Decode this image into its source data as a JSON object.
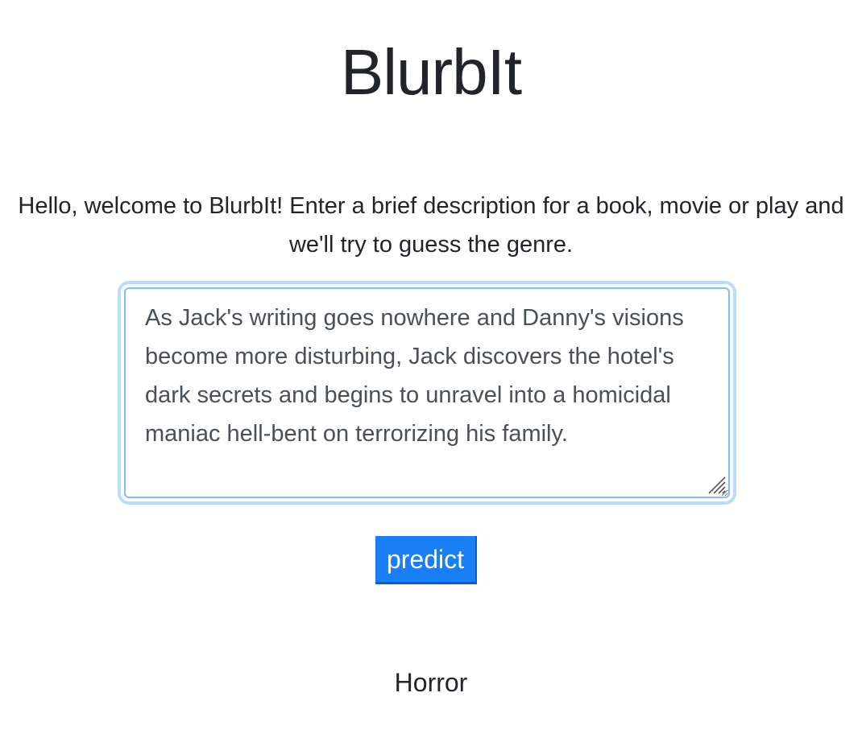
{
  "app": {
    "title": "BlurbIt"
  },
  "intro": {
    "text": "Hello, welcome to BlurbIt! Enter a brief description for a book, movie or play and we'll try to guess the genre."
  },
  "description_input": {
    "value": "As Jack's writing goes nowhere and Danny's visions become more disturbing, Jack discovers the hotel's dark secrets and begins to unravel into a homicidal maniac hell-bent on terrorizing his family."
  },
  "predict_button": {
    "label": "predict"
  },
  "result": {
    "genre": "Horror"
  },
  "colors": {
    "button_bg": "#1a7ff6",
    "focus_ring": "#80bdff",
    "text": "#212529",
    "input_text": "#495057"
  },
  "icons": {
    "resize_grip": "resize-grip-icon"
  }
}
